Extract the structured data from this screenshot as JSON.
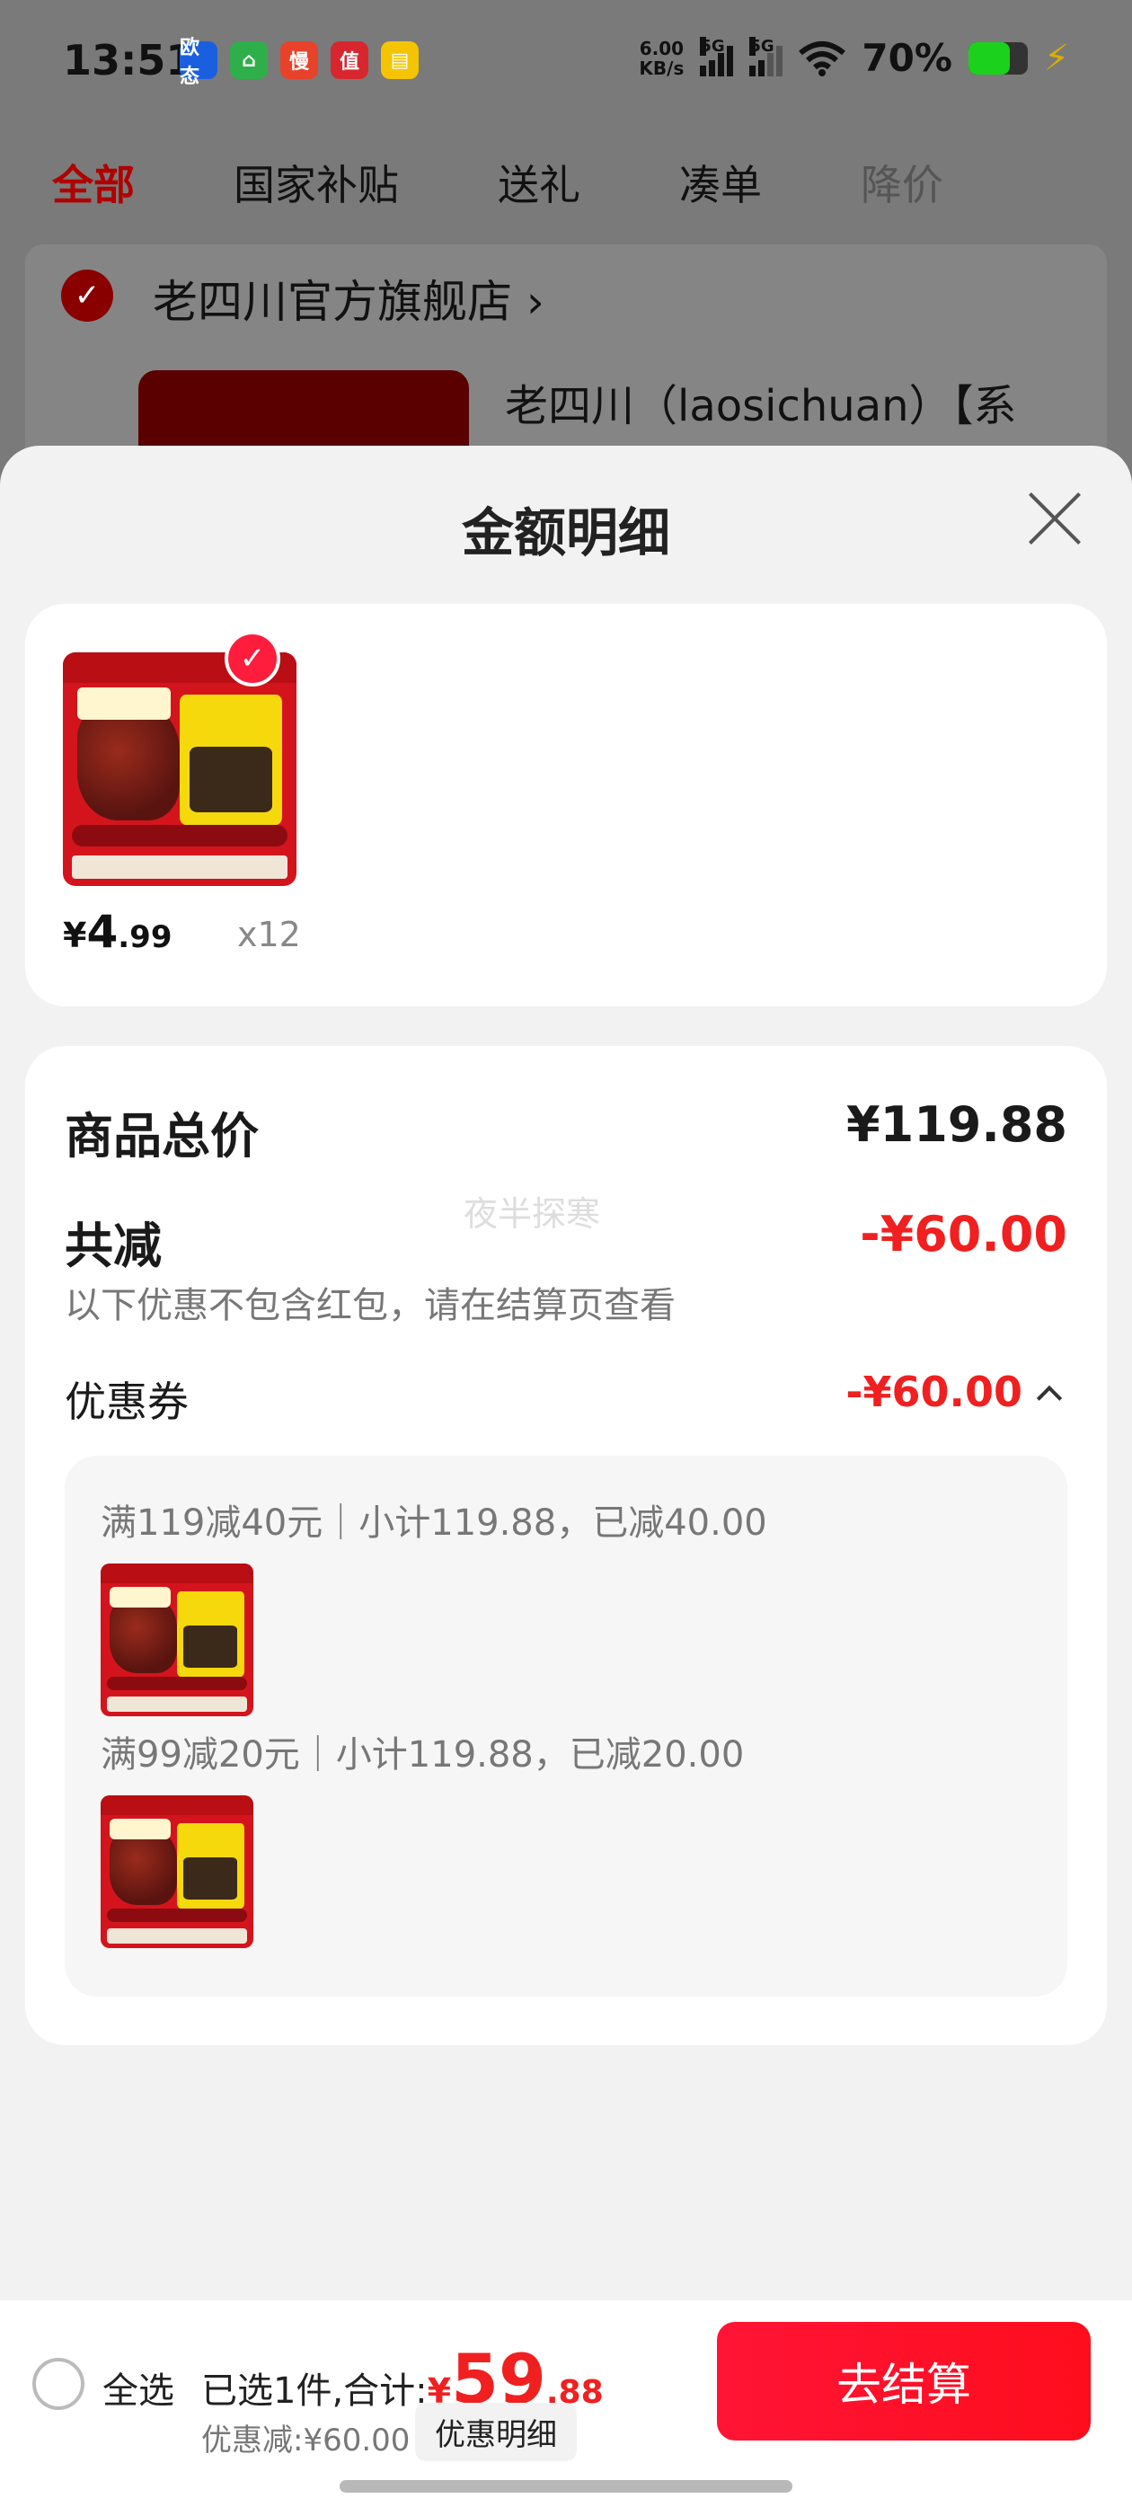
{
  "status_bar": {
    "time": "13:51",
    "notif_icons": [
      {
        "name": "oppo-app-icon",
        "label": "欧态",
        "color": "#1a5fe0"
      },
      {
        "name": "home-app-icon",
        "label": "⌂",
        "color": "#2faf4a"
      },
      {
        "name": "man-app-icon",
        "label": "慢",
        "color": "#e8422a"
      },
      {
        "name": "zhi-app-icon",
        "label": "值",
        "color": "#d8262e"
      },
      {
        "name": "notes-app-icon",
        "label": "▤",
        "color": "#f5c400"
      }
    ],
    "net_speed_value": "6.00",
    "net_speed_unit": "KB/s",
    "sim1": "5G",
    "sim2": "5G",
    "battery_percent": "70%",
    "battery_level": 0.7
  },
  "tabs": [
    {
      "label": "全部",
      "active": true
    },
    {
      "label": "国家补贴"
    },
    {
      "label": "送礼"
    },
    {
      "label": "凑单"
    },
    {
      "label": "降价",
      "dim": true
    }
  ],
  "store": {
    "name": "老四川官方旗舰店",
    "chevron": "›",
    "product_title": "老四川（laosichuan）【系"
  },
  "sheet": {
    "title": "金额明细",
    "product": {
      "currency": "¥",
      "price_int": "4",
      "price_dec": ".99",
      "quantity": "x12"
    },
    "detail": {
      "total_label": "商品总价",
      "total_value": "¥119.88",
      "reduce_label": "共减",
      "reduce_value": "-¥60.00",
      "note": "以下优惠不包含红包，请在结算页查看",
      "watermark": "夜半探寒",
      "coupon_label": "优惠券",
      "coupon_value": "-¥60.00",
      "coupons": [
        {
          "rule": "满119减40元｜小计119.88，已减40.00"
        },
        {
          "rule": "满99减20元｜小计119.88，已减20.00"
        }
      ]
    }
  },
  "bottom_bar": {
    "select_all": "全选",
    "selected_text": "已选1件,合计:",
    "total_currency": "¥",
    "total_int": "59",
    "total_dec": ".88",
    "discount": "优惠减:¥60.00",
    "detail_chip": "优惠明细",
    "checkout": "去结算"
  }
}
